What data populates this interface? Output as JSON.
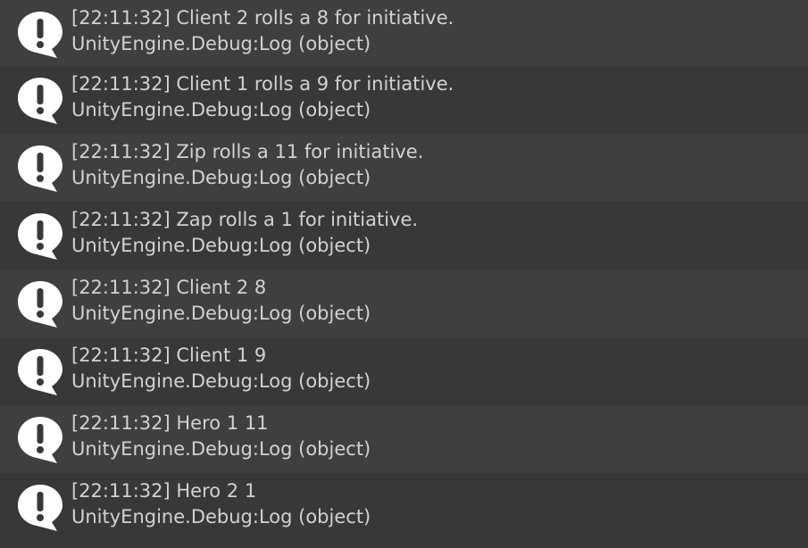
{
  "console": {
    "colors": {
      "background": "#383838",
      "row_alt": "#3f3f3f",
      "text": "#d2d2d2",
      "icon": "#ffffff"
    },
    "icon_name": "info-log-icon",
    "entries": [
      {
        "message": "[22:11:32] Client 2 rolls a 8 for initiative.",
        "source": "UnityEngine.Debug:Log (object)"
      },
      {
        "message": "[22:11:32] Client 1 rolls a 9 for initiative.",
        "source": "UnityEngine.Debug:Log (object)"
      },
      {
        "message": "[22:11:32] Zip rolls a 11 for initiative.",
        "source": "UnityEngine.Debug:Log (object)"
      },
      {
        "message": "[22:11:32] Zap rolls a 1 for initiative.",
        "source": "UnityEngine.Debug:Log (object)"
      },
      {
        "message": "[22:11:32] Client 2 8",
        "source": "UnityEngine.Debug:Log (object)"
      },
      {
        "message": "[22:11:32] Client 1 9",
        "source": "UnityEngine.Debug:Log (object)"
      },
      {
        "message": "[22:11:32] Hero 1 11",
        "source": "UnityEngine.Debug:Log (object)"
      },
      {
        "message": "[22:11:32] Hero 2 1",
        "source": "UnityEngine.Debug:Log (object)"
      }
    ]
  }
}
